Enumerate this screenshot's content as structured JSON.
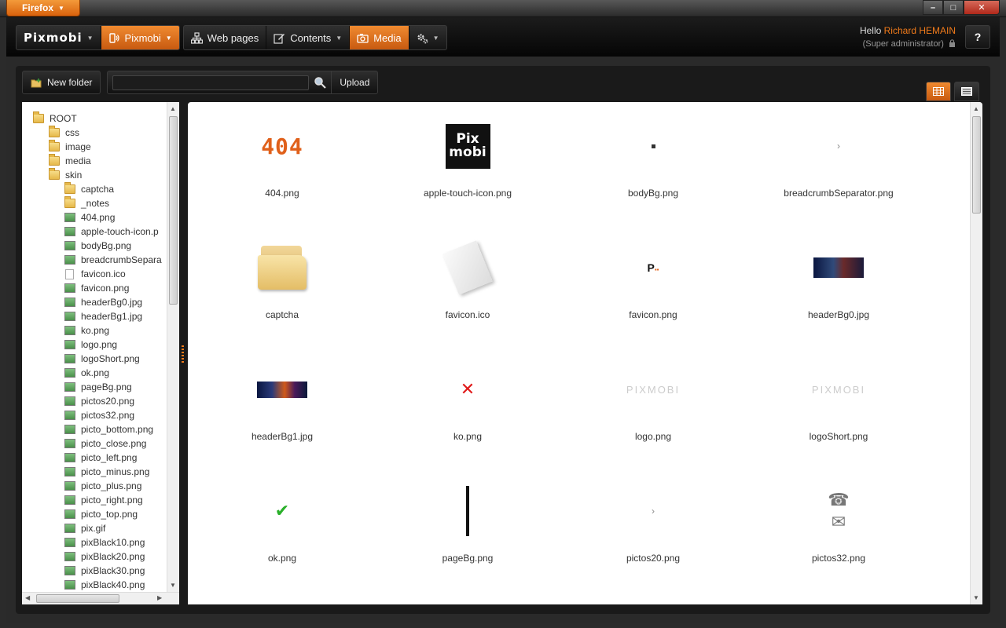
{
  "browser": {
    "menu_label": "Firefox",
    "window_controls": [
      "–",
      "□",
      "✕"
    ]
  },
  "app": {
    "logo": "Pixmobi",
    "nav": [
      {
        "label": "Pixmobi",
        "icon": "phone-signal-icon",
        "active": true
      },
      {
        "label": "Web pages",
        "icon": "sitemap-icon",
        "active": false
      },
      {
        "label": "Contents",
        "icon": "edit-icon",
        "active": false
      },
      {
        "label": "Media",
        "icon": "camera-icon",
        "active": true
      },
      {
        "label": "",
        "icon": "gears-icon",
        "active": false
      }
    ],
    "user": {
      "greeting": "Hello",
      "name": "Richard HEMAIN",
      "role": "(Super administrator)"
    },
    "help_label": "?"
  },
  "toolbar": {
    "new_folder_label": "New folder",
    "search_value": "",
    "search_placeholder": "",
    "upload_label": "Upload",
    "view_modes": [
      "thumbnails",
      "list"
    ],
    "active_view": "thumbnails"
  },
  "tree": {
    "root": "ROOT",
    "items": [
      {
        "label": "ROOT",
        "type": "folder",
        "level": 0
      },
      {
        "label": "css",
        "type": "folder",
        "level": 1
      },
      {
        "label": "image",
        "type": "folder",
        "level": 1
      },
      {
        "label": "media",
        "type": "folder",
        "level": 1
      },
      {
        "label": "skin",
        "type": "folder",
        "level": 1
      },
      {
        "label": "captcha",
        "type": "folder",
        "level": 2
      },
      {
        "label": "_notes",
        "type": "folder",
        "level": 2
      },
      {
        "label": "404.png",
        "type": "image",
        "level": 2
      },
      {
        "label": "apple-touch-icon.p",
        "type": "image",
        "level": 2
      },
      {
        "label": "bodyBg.png",
        "type": "image",
        "level": 2
      },
      {
        "label": "breadcrumbSepara",
        "type": "image",
        "level": 2
      },
      {
        "label": "favicon.ico",
        "type": "file",
        "level": 2
      },
      {
        "label": "favicon.png",
        "type": "image",
        "level": 2
      },
      {
        "label": "headerBg0.jpg",
        "type": "image",
        "level": 2
      },
      {
        "label": "headerBg1.jpg",
        "type": "image",
        "level": 2
      },
      {
        "label": "ko.png",
        "type": "image",
        "level": 2
      },
      {
        "label": "logo.png",
        "type": "image",
        "level": 2
      },
      {
        "label": "logoShort.png",
        "type": "image",
        "level": 2
      },
      {
        "label": "ok.png",
        "type": "image",
        "level": 2
      },
      {
        "label": "pageBg.png",
        "type": "image",
        "level": 2
      },
      {
        "label": "pictos20.png",
        "type": "image",
        "level": 2
      },
      {
        "label": "pictos32.png",
        "type": "image",
        "level": 2
      },
      {
        "label": "picto_bottom.png",
        "type": "image",
        "level": 2
      },
      {
        "label": "picto_close.png",
        "type": "image",
        "level": 2
      },
      {
        "label": "picto_left.png",
        "type": "image",
        "level": 2
      },
      {
        "label": "picto_minus.png",
        "type": "image",
        "level": 2
      },
      {
        "label": "picto_plus.png",
        "type": "image",
        "level": 2
      },
      {
        "label": "picto_right.png",
        "type": "image",
        "level": 2
      },
      {
        "label": "picto_top.png",
        "type": "image",
        "level": 2
      },
      {
        "label": "pix.gif",
        "type": "image",
        "level": 2
      },
      {
        "label": "pixBlack10.png",
        "type": "image",
        "level": 2
      },
      {
        "label": "pixBlack20.png",
        "type": "image",
        "level": 2
      },
      {
        "label": "pixBlack30.png",
        "type": "image",
        "level": 2
      },
      {
        "label": "pixBlack40.png",
        "type": "image",
        "level": 2
      }
    ]
  },
  "grid": {
    "items": [
      {
        "name": "404.png",
        "thumb": "404"
      },
      {
        "name": "apple-touch-icon.png",
        "thumb": "appicon"
      },
      {
        "name": "bodyBg.png",
        "thumb": "dot"
      },
      {
        "name": "breadcrumbSeparator.png",
        "thumb": "chev"
      },
      {
        "name": "captcha",
        "thumb": "folder"
      },
      {
        "name": "favicon.ico",
        "thumb": "doc"
      },
      {
        "name": "favicon.png",
        "thumb": "fav"
      },
      {
        "name": "headerBg0.jpg",
        "thumb": "hdr0"
      },
      {
        "name": "headerBg1.jpg",
        "thumb": "hdr1"
      },
      {
        "name": "ko.png",
        "thumb": "ko"
      },
      {
        "name": "logo.png",
        "thumb": "logo"
      },
      {
        "name": "logoShort.png",
        "thumb": "logo"
      },
      {
        "name": "ok.png",
        "thumb": "ok"
      },
      {
        "name": "pageBg.png",
        "thumb": "bar"
      },
      {
        "name": "pictos20.png",
        "thumb": "chev"
      },
      {
        "name": "pictos32.png",
        "thumb": "pictos32"
      }
    ]
  },
  "thumb_text": {
    "t404": "404",
    "appicon_line1": "Pix",
    "appicon_line2": "mobi",
    "fav": "P",
    "ko": "✕",
    "ok": "✔",
    "chev": "›",
    "logo": "PIXMOBI",
    "phone": "☎",
    "mail": "✉"
  },
  "colors": {
    "accent": "#f07a1a",
    "header_bg": "#111111",
    "panel_bg": "#1a1a1a"
  }
}
